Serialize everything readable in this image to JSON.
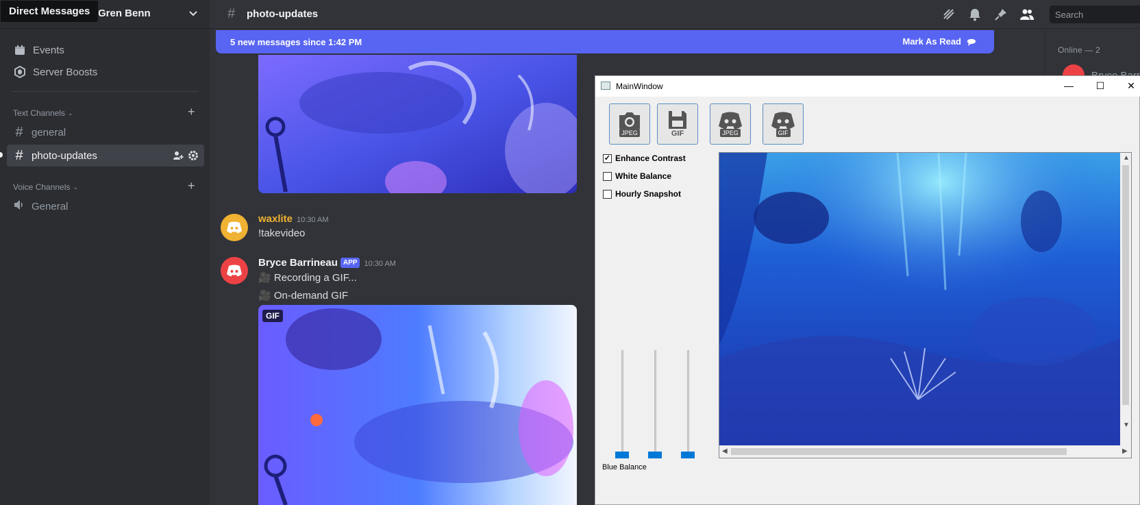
{
  "tooltip": "Direct Messages",
  "server": {
    "name": "Gren Benn"
  },
  "sidebar": {
    "items": [
      {
        "label": "Events",
        "icon": "calendar-icon"
      },
      {
        "label": "Server Boosts",
        "icon": "boost-icon"
      }
    ],
    "text_category": "Text Channels",
    "text_channels": [
      "general",
      "photo-updates"
    ],
    "voice_category": "Voice Channels",
    "voice_channels": [
      "General"
    ]
  },
  "channel": {
    "name": "photo-updates"
  },
  "search": {
    "placeholder": "Search"
  },
  "banner": {
    "text": "5 new messages since 1:42 PM",
    "action": "Mark As Read"
  },
  "messages": [
    {
      "author": "waxlite",
      "time": "10:30 AM",
      "lines": [
        "!takevideo"
      ],
      "avatar_color": "#f0b232"
    },
    {
      "author": "Bryce Barrineau",
      "badge": "APP",
      "time": "10:30 AM",
      "lines": [
        "🎥 Recording a GIF...",
        "🎥 On-demand GIF"
      ],
      "avatar_color": "#ed4245",
      "attachment_tag": "GIF"
    }
  ],
  "members": {
    "heading": "Online — 2",
    "first": "Bryce Barr"
  },
  "window": {
    "title": "MainWindow",
    "buttons": [
      {
        "icon": "camera-icon",
        "label": "JPEG"
      },
      {
        "icon": "save-icon",
        "label": "GIF"
      },
      {
        "icon": "discord-icon",
        "label": "JPEG"
      },
      {
        "icon": "discord-icon",
        "label": "GIF"
      }
    ],
    "checkboxes": [
      {
        "label": "Enhance Contrast",
        "checked": true
      },
      {
        "label": "White Balance",
        "checked": false
      },
      {
        "label": "Hourly Snapshot",
        "checked": false
      }
    ],
    "slider_label": "Blue Balance",
    "sliders": [
      0,
      0,
      0
    ]
  },
  "colors": {
    "blurple": "#5865f2",
    "win_accent": "#0078d7",
    "danger": "#ed4245"
  }
}
